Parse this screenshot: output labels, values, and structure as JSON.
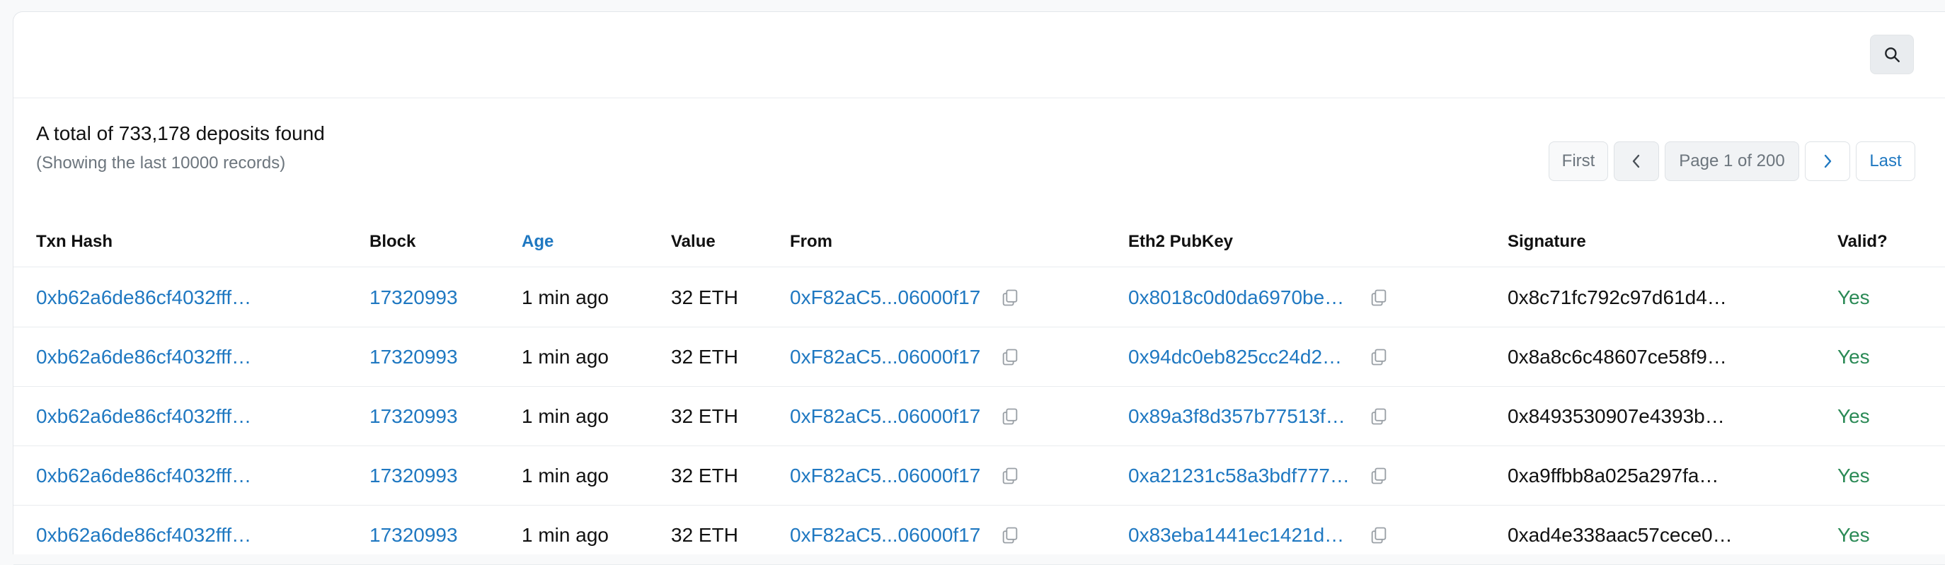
{
  "summary": {
    "title": "A total of 733,178 deposits found",
    "subtitle": "(Showing the last 10000 records)"
  },
  "pagination": {
    "first": "First",
    "prev_icon": "chevron-left-icon",
    "page_text": "Page 1 of 200",
    "next_icon": "chevron-right-icon",
    "last": "Last"
  },
  "search": {
    "icon": "search-icon"
  },
  "table": {
    "columns": [
      "Txn Hash",
      "Block",
      "Age",
      "Value",
      "From",
      "Eth2 PubKey",
      "Signature",
      "Valid?"
    ],
    "sorted_column": "Age",
    "rows": [
      {
        "txn_hash": "0xb62a6de86cf4032fff…",
        "block": "17320993",
        "age": "1 min ago",
        "value": "32 ETH",
        "from": "0xF82aC5...06000f17",
        "pubkey": "0x8018c0d0da6970be…",
        "signature": "0x8c71fc792c97d61d4…",
        "valid": "Yes"
      },
      {
        "txn_hash": "0xb62a6de86cf4032fff…",
        "block": "17320993",
        "age": "1 min ago",
        "value": "32 ETH",
        "from": "0xF82aC5...06000f17",
        "pubkey": "0x94dc0eb825cc24d2…",
        "signature": "0x8a8c6c48607ce58f9…",
        "valid": "Yes"
      },
      {
        "txn_hash": "0xb62a6de86cf4032fff…",
        "block": "17320993",
        "age": "1 min ago",
        "value": "32 ETH",
        "from": "0xF82aC5...06000f17",
        "pubkey": "0x89a3f8d357b77513f…",
        "signature": "0x8493530907e4393b…",
        "valid": "Yes"
      },
      {
        "txn_hash": "0xb62a6de86cf4032fff…",
        "block": "17320993",
        "age": "1 min ago",
        "value": "32 ETH",
        "from": "0xF82aC5...06000f17",
        "pubkey": "0xa21231c58a3bdf777…",
        "signature": "0xa9ffbb8a025a297fa…",
        "valid": "Yes"
      },
      {
        "txn_hash": "0xb62a6de86cf4032fff…",
        "block": "17320993",
        "age": "1 min ago",
        "value": "32 ETH",
        "from": "0xF82aC5...06000f17",
        "pubkey": "0x83eba1441ec1421d…",
        "signature": "0xad4e338aac57cece0…",
        "valid": "Yes"
      }
    ]
  },
  "colors": {
    "link": "#1f78c1",
    "valid": "#2b8a56",
    "muted": "#6c757d"
  }
}
